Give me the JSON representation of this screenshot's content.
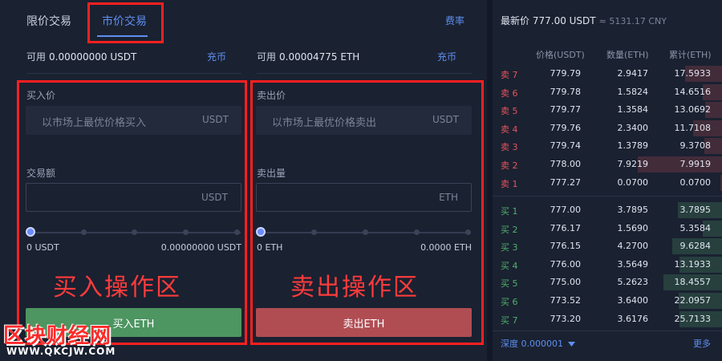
{
  "tabs": {
    "limit": "限价交易",
    "market": "市价交易",
    "fee": "费率"
  },
  "buy": {
    "balance_label": "可用",
    "balance_value": "0.00000000 USDT",
    "recharge": "充币",
    "price_label": "买入价",
    "price_placeholder": "以市场上最优价格买入",
    "price_unit": "USDT",
    "amount_label": "交易额",
    "amount_unit": "USDT",
    "range_min": "0 USDT",
    "range_max": "0.00000000 USDT",
    "zone_label": "买入操作区",
    "button": "买入ETH"
  },
  "sell": {
    "balance_label": "可用",
    "balance_value": "0.00004775 ETH",
    "recharge": "充币",
    "price_label": "卖出价",
    "price_placeholder": "以市场上最优价格卖出",
    "price_unit": "USDT",
    "amount_label": "卖出量",
    "amount_unit": "ETH",
    "range_min": "0 ETH",
    "range_max": "0.0000 ETH",
    "zone_label": "卖出操作区",
    "button": "卖出ETH"
  },
  "orderbook": {
    "latest_label": "最新价",
    "latest_price": "777.00 USDT",
    "latest_cny": "≈ 5131.17 CNY",
    "col_price": "价格(USDT)",
    "col_qty": "数量(ETH)",
    "col_cum": "累计(ETH)",
    "asks": [
      {
        "side": "卖 7",
        "price": "779.79",
        "qty": "2.9417",
        "cum": "17.5933",
        "depth": 0.42
      },
      {
        "side": "卖 6",
        "price": "779.78",
        "qty": "1.5824",
        "cum": "14.6516",
        "depth": 0.22
      },
      {
        "side": "卖 5",
        "price": "779.77",
        "qty": "1.3584",
        "cum": "13.0692",
        "depth": 0.19
      },
      {
        "side": "卖 4",
        "price": "779.76",
        "qty": "2.3400",
        "cum": "11.7108",
        "depth": 0.33
      },
      {
        "side": "卖 3",
        "price": "779.74",
        "qty": "1.3789",
        "cum": "9.3708",
        "depth": 0.2
      },
      {
        "side": "卖 2",
        "price": "778.00",
        "qty": "7.9219",
        "cum": "7.9919",
        "depth": 0.95
      },
      {
        "side": "卖 1",
        "price": "777.27",
        "qty": "0.0700",
        "cum": "0.0700",
        "depth": 0.02
      }
    ],
    "bids": [
      {
        "side": "买 1",
        "price": "777.00",
        "qty": "3.7895",
        "cum": "3.7895",
        "depth": 0.5
      },
      {
        "side": "买 2",
        "price": "776.17",
        "qty": "1.5690",
        "cum": "5.3584",
        "depth": 0.22
      },
      {
        "side": "买 3",
        "price": "776.15",
        "qty": "4.2700",
        "cum": "9.6284",
        "depth": 0.56
      },
      {
        "side": "买 4",
        "price": "776.00",
        "qty": "3.5649",
        "cum": "13.1933",
        "depth": 0.48
      },
      {
        "side": "买 5",
        "price": "775.00",
        "qty": "5.2623",
        "cum": "18.4557",
        "depth": 0.66
      },
      {
        "side": "买 6",
        "price": "773.52",
        "qty": "3.6400",
        "cum": "22.0957",
        "depth": 0.49
      },
      {
        "side": "买 7",
        "price": "773.20",
        "qty": "3.6176",
        "cum": "25.7133",
        "depth": 0.48
      }
    ],
    "depth_label": "深度 0.000001",
    "more": "更多"
  },
  "watermark": {
    "brand": "区块财经网",
    "url": "WWW.QKCJW.COM"
  },
  "colors": {
    "accent": "#5f8ff0",
    "buy": "#4d9561",
    "sell": "#b04d53",
    "ask_text": "#e4555b",
    "bid_text": "#4fb06a",
    "annotation": "#ff2020"
  },
  "icons": {
    "depth_caret": "caret-down-icon"
  }
}
